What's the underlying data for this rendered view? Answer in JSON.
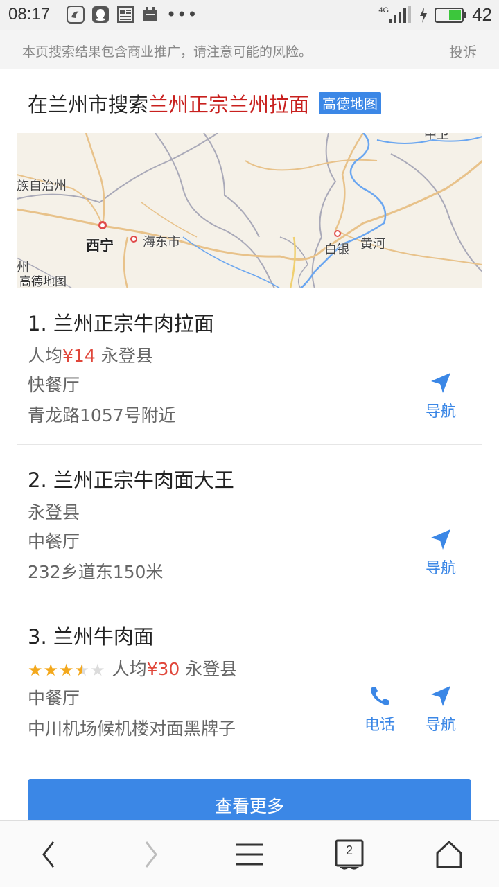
{
  "status_bar": {
    "time": "08:17",
    "more_dots": "•••",
    "network": "4G",
    "battery": "42",
    "icons": [
      "uc-browser-icon",
      "qq-icon",
      "news-icon",
      "calendar-icon",
      "signal-icon",
      "charging-icon",
      "battery-icon"
    ]
  },
  "ad_notice": {
    "text": "本页搜索结果包含商业推广，请注意可能的风险。",
    "complain_label": "投诉"
  },
  "search": {
    "prefix": "在兰州市搜索",
    "query": "兰州正宗兰州拉面",
    "badge": "高德地图"
  },
  "map": {
    "labels": {
      "autonomous": "族自治州",
      "xining": "西宁",
      "haidong": "海东市",
      "baiyin": "白银",
      "huanghe": "黄河",
      "zhou": "州",
      "watermark": "高德地图",
      "corner": "中卫"
    },
    "colors": {
      "road": "#e8c28a",
      "boundary": "#a9a9b8",
      "river": "#6aa6f0",
      "land": "#f5f1e8"
    }
  },
  "results": [
    {
      "title": "1. 兰州正宗牛肉拉面",
      "per_capita_label": "人均",
      "price": "¥14",
      "district": "永登县",
      "category": "快餐厅",
      "address": "青龙路1057号附近",
      "nav_label": "导航"
    },
    {
      "title": "2. 兰州正宗牛肉面大王",
      "district": "永登县",
      "category": "中餐厅",
      "address": "232乡道东150米",
      "nav_label": "导航"
    },
    {
      "title": "3. 兰州牛肉面",
      "rating": 3.5,
      "rating_max": 5,
      "per_capita_label": "人均",
      "price": "¥30",
      "district": "永登县",
      "category": "中餐厅",
      "address": "中川机场候机楼对面黑牌子",
      "phone_label": "电话",
      "nav_label": "导航"
    }
  ],
  "more_button": "查看更多",
  "bottom_nav": {
    "tab_count": "2"
  },
  "colors": {
    "accent": "#3b87e6",
    "highlight": "#c8201e",
    "price": "#e0463a",
    "star": "#f3a81c"
  }
}
